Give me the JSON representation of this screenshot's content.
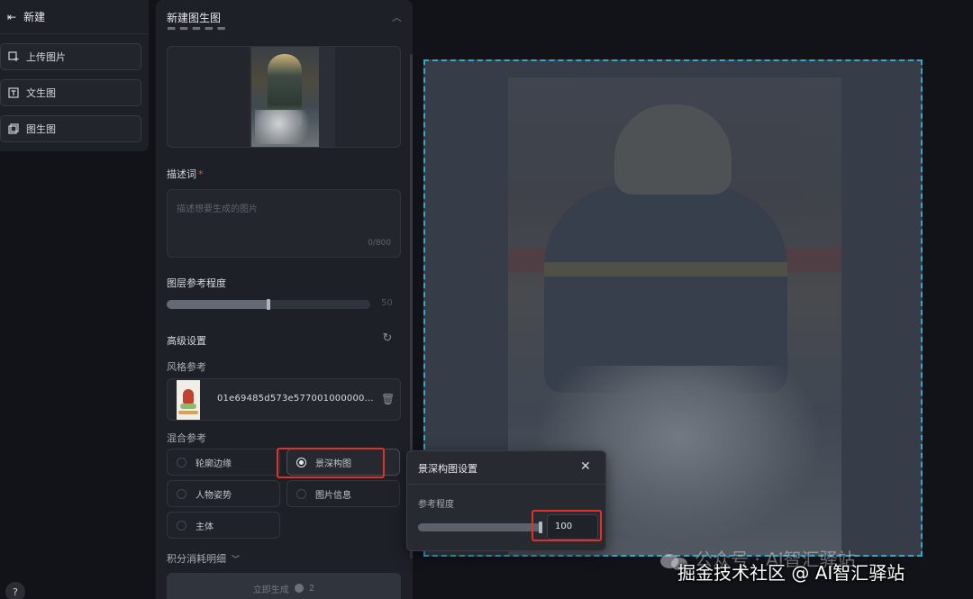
{
  "nav": {
    "header": "新建",
    "items": [
      {
        "label": "上传图片",
        "icon": "image-upload-icon"
      },
      {
        "label": "文生图",
        "icon": "text-to-image-icon"
      },
      {
        "label": "图生图",
        "icon": "image-to-image-icon"
      }
    ],
    "help": "?"
  },
  "panel": {
    "title": "新建图生图",
    "prompt_label": "描述词",
    "required_mark": "*",
    "prompt_placeholder": "描述想要生成的图片",
    "prompt_counter": "0/800",
    "layer_ref_label": "图层参考程度",
    "layer_ref_value": 50,
    "advanced_label": "高级设置",
    "style_ref_label": "风格参考",
    "style_ref_name": "01e69485d573e577001000000...",
    "mix_ref_label": "混合参考",
    "mix_options": [
      {
        "label": "轮廓边缘",
        "selected": false
      },
      {
        "label": "景深构图",
        "selected": true
      },
      {
        "label": "人物姿势",
        "selected": false
      },
      {
        "label": "图片信息",
        "selected": false
      },
      {
        "label": "主体",
        "selected": false
      }
    ],
    "cost_label": "积分消耗明细",
    "generate_label": "立即生成",
    "generate_cost": "2"
  },
  "popover": {
    "title": "景深构图设置",
    "close": "✕",
    "ref_label": "参考程度",
    "ref_value": "100",
    "ref_fraction": 1.0
  },
  "watermark": {
    "line1": "公众号 · AI智汇驿站",
    "line2": "掘金技术社区 @ AI智汇驿站"
  },
  "colors": {
    "canvas_border": "#3aa7c4",
    "highlight": "#e0322a",
    "required": "#e2544a"
  }
}
